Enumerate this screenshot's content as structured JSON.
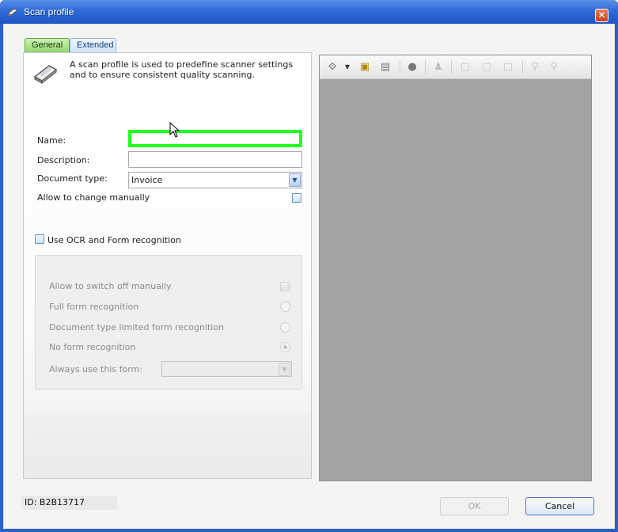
{
  "window": {
    "title": "Scan profile",
    "close_label": "✕"
  },
  "tabs": [
    {
      "label": "General",
      "active": true
    },
    {
      "label": "Extended",
      "active": false
    }
  ],
  "general": {
    "intro": "A scan profile is used to predefine scanner settings and to ensure consistent quality scanning.",
    "name_label": "Name:",
    "name_value": "",
    "description_label": "Description:",
    "description_value": "",
    "document_type_label": "Document type:",
    "document_type_value": "Invoice",
    "allow_change_label": "Allow to change manually",
    "use_ocr_label": "Use OCR and Form recognition",
    "ocr": {
      "allow_switch_off_label": "Allow to switch off manually",
      "full_form_label": "Full form recognition",
      "limited_form_label": "Document type limited form recognition",
      "no_form_label": "No form recognition",
      "always_use_form_label": "Always use this form:"
    }
  },
  "footer": {
    "id_text": "ID: B2B13717",
    "ok_label": "OK",
    "cancel_label": "Cancel"
  },
  "colors": {
    "title_bar": "#2f6ad8",
    "active_tab": "#8fd66a",
    "name_highlight": "#21ff21",
    "preview_bg": "#a3a3a3"
  },
  "icons": {
    "title": "scanner-icon",
    "close": "close-icon",
    "toolbar": [
      "navigate-icon",
      "dropdown-arrow-icon",
      "scan-page-icon",
      "import-page-icon",
      "delete-icon",
      "stamp-icon",
      "rotate-left-icon",
      "rotate-right-icon",
      "flip-icon",
      "zoom-in-icon",
      "zoom-out-icon"
    ]
  }
}
